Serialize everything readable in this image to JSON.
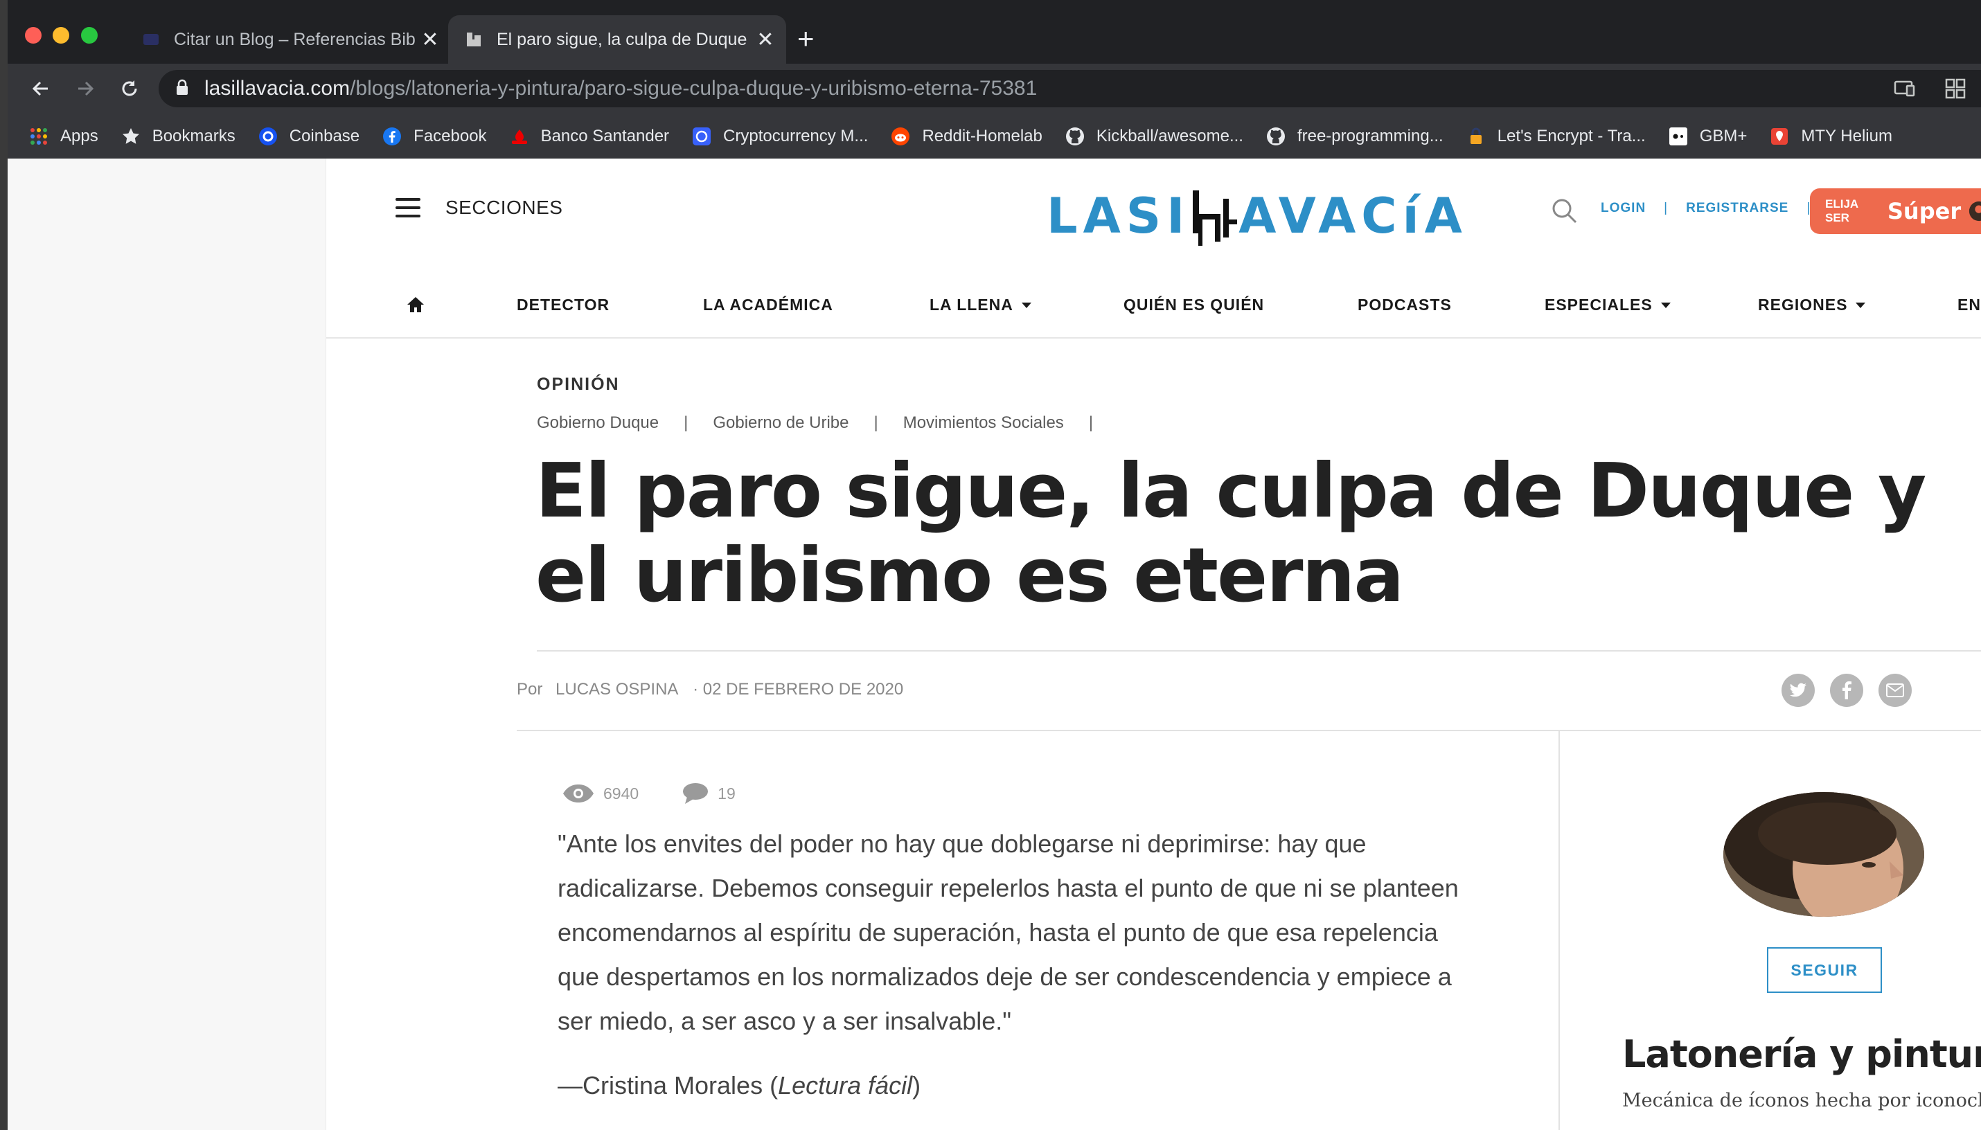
{
  "browser": {
    "tabs": [
      {
        "title": "Citar un Blog – Referencias Bibliográficas",
        "active": false
      },
      {
        "title": "El paro sigue, la culpa de Duque y el uribismo es eterna",
        "active": true
      }
    ],
    "new_tab": "+",
    "close_glyph": "✕",
    "url_host": "lasillavacia.com",
    "url_path": "/blogs/latoneria-y-pintura/paro-sigue-culpa-duque-y-uribismo-eterna-75381",
    "bookmarks": [
      {
        "label": "Apps",
        "icon": "apps-grid-icon"
      },
      {
        "label": "Bookmarks",
        "icon": "star-icon"
      },
      {
        "label": "Coinbase",
        "icon": "coinbase-icon"
      },
      {
        "label": "Facebook",
        "icon": "facebook-icon"
      },
      {
        "label": "Banco Santander",
        "icon": "santander-icon"
      },
      {
        "label": "Cryptocurrency M...",
        "icon": "coinmarketcap-icon"
      },
      {
        "label": "Reddit-Homelab",
        "icon": "reddit-icon"
      },
      {
        "label": "Kickball/awesome...",
        "icon": "github-icon"
      },
      {
        "label": "free-programming...",
        "icon": "github-icon"
      },
      {
        "label": "Let's Encrypt - Tra...",
        "icon": "letsencrypt-icon"
      },
      {
        "label": "GBM+",
        "icon": "gbm-icon"
      },
      {
        "label": "MTY Helium",
        "icon": "map-pin-icon"
      }
    ]
  },
  "site": {
    "sections_label": "SECCIONES",
    "logo_left": "LASI",
    "logo_right": "AVACíA",
    "login": "LOGIN",
    "register": "REGISTRARSE",
    "super_small": "ELIJA SER",
    "super_big": "Súper",
    "nav": [
      {
        "label": "DETECTOR",
        "dropdown": false
      },
      {
        "label": "LA ACADÉMICA",
        "dropdown": false
      },
      {
        "label": "LA LLENA",
        "dropdown": true
      },
      {
        "label": "QUIÉN ES QUIÉN",
        "dropdown": false
      },
      {
        "label": "PODCASTS",
        "dropdown": false
      },
      {
        "label": "ESPECIALES",
        "dropdown": true
      },
      {
        "label": "REGIONES",
        "dropdown": true
      },
      {
        "label": "EN V",
        "dropdown": false
      }
    ]
  },
  "article": {
    "kicker": "OPINIÓN",
    "tags": [
      "Gobierno Duque",
      "Gobierno de Uribe",
      "Movimientos Sociales"
    ],
    "headline": "El paro sigue, la culpa de Duque y el uribismo es eterna",
    "byline_prefix": "Por",
    "author": "LUCAS OSPINA",
    "date": "· 02 DE FEBRERO DE 2020",
    "views": "6940",
    "comments": "19",
    "quote": "\"Ante los envites del poder no hay que doblegarse ni deprimirse: hay que radicalizarse. Debemos conseguir repelerlos hasta el punto de que ni se planteen encomendarnos al espíritu de superación, hasta el punto de que esa repelencia que despertamos en los normalizados deje de ser condescendencia y empiece a ser miedo, a ser asco y a ser insalvable.\"",
    "attribution_prefix": "—Cristina Morales (",
    "attribution_title": "Lectura fácil",
    "attribution_suffix": ")"
  },
  "sidebar": {
    "follow_label": "SEGUIR",
    "blog_title": "Latonería y pintura",
    "blog_subtitle": "Mecánica de íconos hecha por iconoclasta"
  },
  "colors": {
    "brand_blue": "#2d8fc7",
    "super_orange": "#ee6a4d",
    "chrome_dark": "#202124",
    "chrome_toolbar": "#35363a"
  }
}
